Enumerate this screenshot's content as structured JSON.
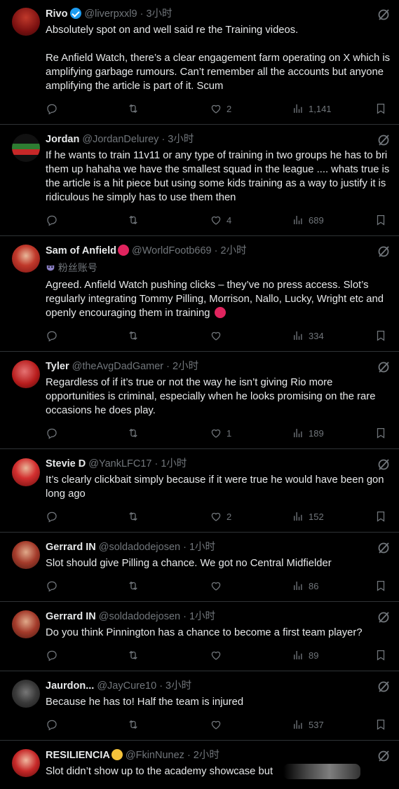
{
  "tweets": [
    {
      "name": "Rivo",
      "handle": "@liverpxxl9",
      "time": "· 3小时",
      "verified": true,
      "body": "Absolutely spot on and well said re the Training videos.\n\nRe Anfield Watch, there’s a clear engagement farm operating on X which is\namplifying garbage rumours. Can’t remember all the accounts but anyone\namplifying the article is part of it. Scum",
      "likes": "2",
      "views": "1,141",
      "avatar_color": "#8b1a1a"
    },
    {
      "name": "Jordan",
      "handle": "@JordanDelurey",
      "time": "· 3小时",
      "body": "If he wants to train 11v11 or any type of training in two groups he has to bri\nthem up hahaha we have the smallest squad in the league .... whats true is\nthe article is a hit piece but using some kids training as a way to justify it is\nridiculous he simply has to use them then",
      "likes": "4",
      "views": "689",
      "avatar_color": "#2e7d32"
    },
    {
      "name": "Sam of Anfield",
      "handle": "@WorldFootb669",
      "time": "· 2小时",
      "fan_label": "粉丝账号",
      "body": "Agreed. Anfield Watch pushing clicks – they’ve no press access. Slot’s\nregularly integrating Tommy Pilling, Morrison, Nallo, Lucky, Wright etc and\nopenly encouraging them in training",
      "likes": "",
      "views": "334",
      "avatar_color": "#c62828"
    },
    {
      "name": "Tyler",
      "handle": "@theAvgDadGamer",
      "time": "· 2小时",
      "body": "Regardless of if it’s true or not the way he isn’t giving Rio more\nopportunities is criminal, especially when he looks promising on the rare\noccasions he does play.",
      "likes": "1",
      "views": "189",
      "avatar_color": "#b71c1c"
    },
    {
      "name": "Stevie D",
      "handle": "@YankLFC17",
      "time": "· 1小时",
      "body": "It’s clearly clickbait simply because if it were true he would have been gon\nlong ago",
      "likes": "2",
      "views": "152",
      "avatar_color": "#d32f2f"
    },
    {
      "name": "Gerrard IN",
      "handle": "@soldadodejosen",
      "time": "· 1小时",
      "body": "Slot should give Pilling a chance. We got no Central Midfielder",
      "likes": "",
      "views": "86",
      "avatar_color": "#a33a2a"
    },
    {
      "name": "Gerrard IN",
      "handle": "@soldadodejosen",
      "time": "· 1小时",
      "body": "Do you think Pinnington has a chance to become a first team player?",
      "likes": "",
      "views": "89",
      "avatar_color": "#a33a2a"
    },
    {
      "name": "Jaurdon...",
      "handle": "@JayCure10",
      "time": "· 3小时",
      "body": "Because he has to! Half the team is injured",
      "likes": "",
      "views": "537",
      "avatar_color": "#3a3a3a"
    },
    {
      "name": "RESILIENCIA",
      "handle": "@FkinNunez",
      "time": "· 2小时",
      "body": "Slot didn’t show up to the academy showcase but",
      "avatar_color": "#c62828"
    }
  ],
  "icons": {
    "reply": "reply-icon",
    "retweet": "retweet-icon",
    "like": "like-icon",
    "views": "views-icon",
    "bookmark": "bookmark-icon",
    "grok": "grok-icon"
  }
}
